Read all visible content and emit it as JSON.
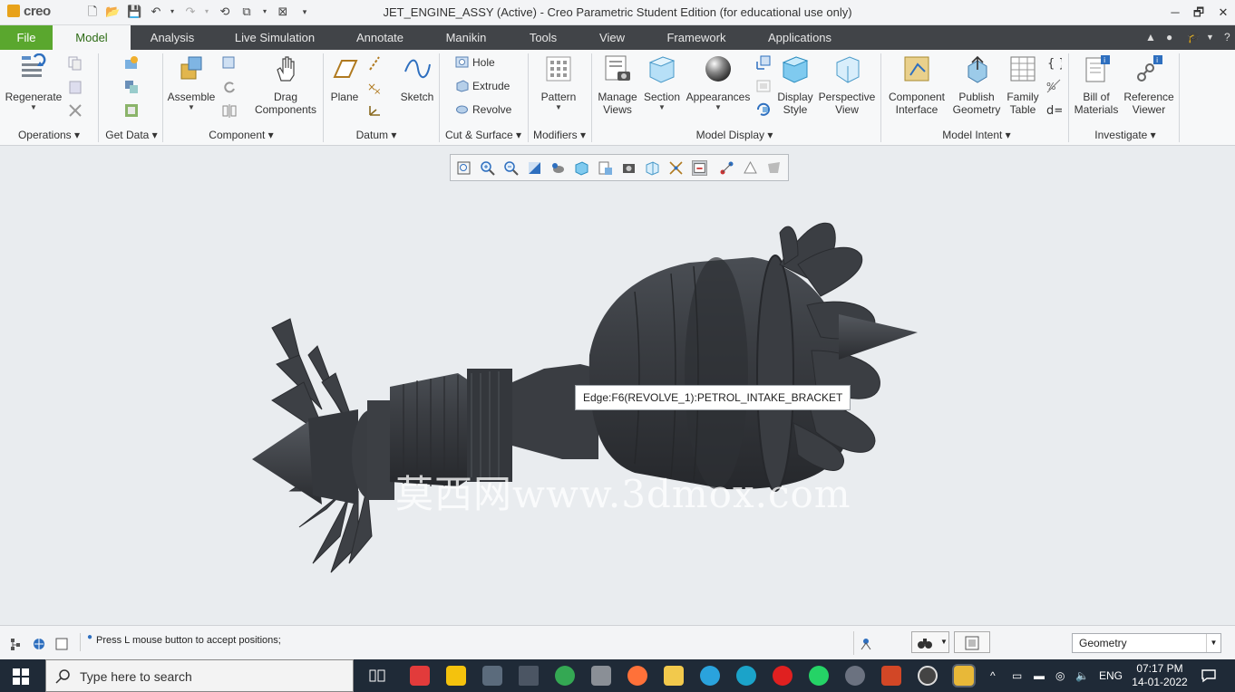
{
  "window": {
    "app_name": "creo",
    "title": "JET_ENGINE_ASSY (Active) - Creo Parametric Student Edition (for educational use only)"
  },
  "tabs": [
    {
      "label": "File"
    },
    {
      "label": "Model"
    },
    {
      "label": "Analysis"
    },
    {
      "label": "Live Simulation"
    },
    {
      "label": "Annotate"
    },
    {
      "label": "Manikin"
    },
    {
      "label": "Tools"
    },
    {
      "label": "View"
    },
    {
      "label": "Framework"
    },
    {
      "label": "Applications"
    }
  ],
  "ribbon": {
    "operations": {
      "label": "Operations",
      "regenerate": "Regenerate"
    },
    "get_data": {
      "label": "Get Data"
    },
    "component": {
      "label": "Component",
      "assemble": "Assemble",
      "drag": "Drag\nComponents"
    },
    "datum": {
      "label": "Datum",
      "plane": "Plane",
      "sketch": "Sketch"
    },
    "cut_surface": {
      "label": "Cut & Surface",
      "hole": "Hole",
      "extrude": "Extrude",
      "revolve": "Revolve"
    },
    "modifiers": {
      "label": "Modifiers",
      "pattern": "Pattern"
    },
    "model_display": {
      "label": "Model Display",
      "manage_views": "Manage\nViews",
      "section": "Section",
      "appearances": "Appearances",
      "display_style": "Display\nStyle",
      "perspective_view": "Perspective\nView"
    },
    "model_intent": {
      "label": "Model Intent",
      "component_interface": "Component\nInterface",
      "publish_geometry": "Publish\nGeometry",
      "family_table": "Family\nTable"
    },
    "investigate": {
      "label": "Investigate",
      "bill_of_materials": "Bill of\nMaterials",
      "reference_viewer": "Reference\nViewer"
    }
  },
  "viewport": {
    "tooltip": "Edge:F6(REVOLVE_1):PETROL_INTAKE_BRACKET",
    "watermark": "莫西网www.3dmox.com"
  },
  "status": {
    "message": "Press L mouse button to accept positions;",
    "filter_value": "Geometry"
  },
  "taskbar": {
    "search_placeholder": "Type here to search",
    "language": "ENG",
    "time": "07:17 PM",
    "date": "14-01-2022"
  },
  "colors": {
    "file_tab": "#5aa72e",
    "tab_bar": "#414448",
    "model_dark": "#3a3d42",
    "taskbar": "#1f2a37"
  }
}
